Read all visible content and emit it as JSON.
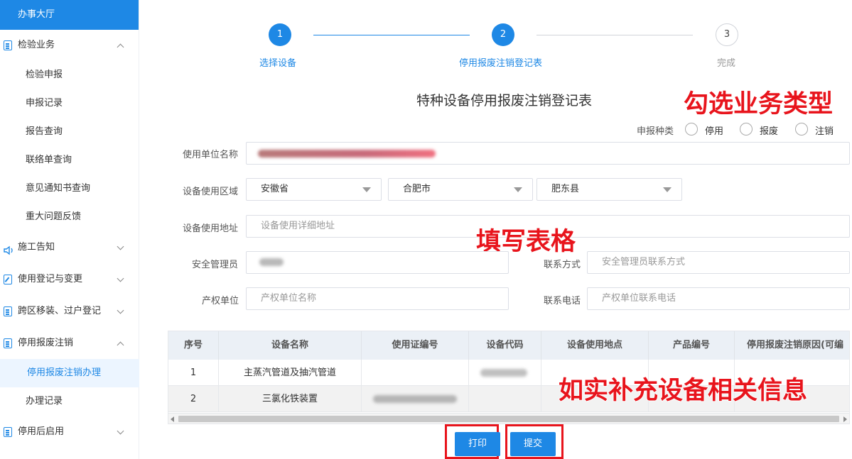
{
  "sidebar": {
    "hall": "办事大厅",
    "groups": [
      {
        "label": "检验业务",
        "items": [
          "检验申报",
          "申报记录",
          "报告查询",
          "联络单查询",
          "意见通知书查询",
          "重大问题反馈"
        ]
      },
      {
        "label": "施工告知"
      },
      {
        "label": "使用登记与变更"
      },
      {
        "label": "跨区移装、过户登记"
      },
      {
        "label": "停用报废注销",
        "items": [
          "停用报废注销办理",
          "办理记录"
        ]
      },
      {
        "label": "停用后启用"
      }
    ]
  },
  "steps": [
    {
      "num": "1",
      "label": "选择设备"
    },
    {
      "num": "2",
      "label": "停用报废注销登记表"
    },
    {
      "num": "3",
      "label": "完成"
    }
  ],
  "form": {
    "title": "特种设备停用报废注销登记表",
    "apply_type_label": "申报种类",
    "apply_types": [
      "停用",
      "报废",
      "注销"
    ],
    "unit_name_label": "使用单位名称",
    "area_label": "设备使用区域",
    "province": "安徽省",
    "city": "合肥市",
    "county": "肥东县",
    "address_label": "设备使用地址",
    "address_placeholder": "设备使用详细地址",
    "safety_manager_label": "安全管理员",
    "contact_label": "联系方式",
    "contact_placeholder": "安全管理员联系方式",
    "owner_unit_label": "产权单位",
    "owner_unit_placeholder": "产权单位名称",
    "owner_phone_label": "联系电话",
    "owner_phone_placeholder": "产权单位联系电话"
  },
  "table": {
    "headers": [
      "序号",
      "设备名称",
      "使用证编号",
      "设备代码",
      "设备使用地点",
      "产品编号",
      "停用报废注销原因(可编"
    ],
    "rows": [
      [
        "1",
        "主蒸汽管道及抽汽管道",
        "",
        "",
        "",
        "",
        ""
      ],
      [
        "2",
        "三氯化铁装置",
        "",
        "",
        "",
        "",
        ""
      ]
    ]
  },
  "buttons": {
    "print": "打印",
    "submit": "提交"
  },
  "annotations": {
    "select_type": "勾选业务类型",
    "fill_form": "填写表格",
    "supplement": "如实补充设备相关信息"
  },
  "colors": {
    "primary": "#1e88e5",
    "annotation": "#e8141c"
  }
}
